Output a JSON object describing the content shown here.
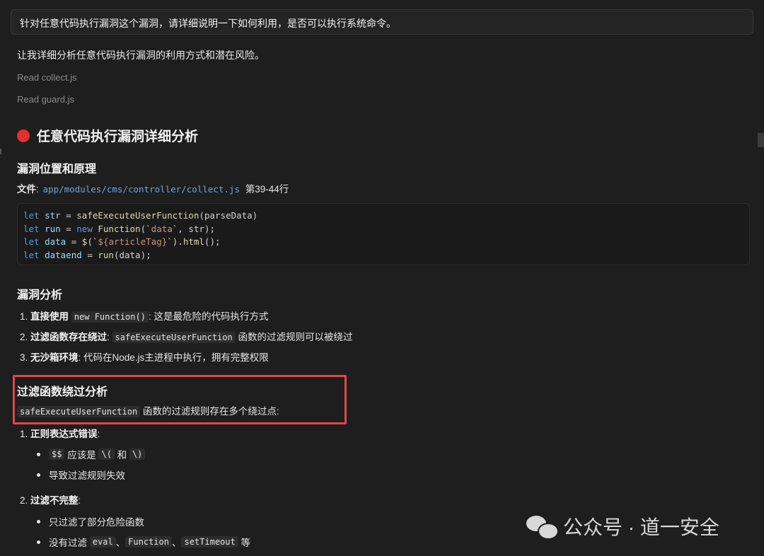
{
  "prompt": "针对任意代码执行漏洞这个漏洞，请详细说明一下如何利用，是否可以执行系统命令。",
  "intro": "让我详细分析任意代码执行漏洞的利用方式和潜在风险。",
  "reads": [
    {
      "label": "Read",
      "file": "collect.js"
    },
    {
      "label": "Read",
      "file": "guard.js"
    }
  ],
  "main_heading": "任意代码执行漏洞详细分析",
  "section1": {
    "heading": "漏洞位置和原理",
    "file_label": "文件",
    "file_path": "app/modules/cms/controller/collect.js",
    "lines": "第39-44行"
  },
  "code": [
    {
      "kw": "let",
      "name": "str",
      "rest": " = ",
      "fn": "safeExecuteUserFunction",
      "args": "(parseData)"
    },
    {
      "kw": "let",
      "name": "run",
      "rest": " = ",
      "kw2": "new",
      "fn": "Function",
      "args1": "(`",
      "strv": "data",
      "args2": "`, str);"
    },
    {
      "kw": "let",
      "name": "data",
      "rest": " = ",
      "fn": "$",
      "args1": "(`",
      "strv": "${articleTag}",
      "args2": "`).",
      "fn2": "html",
      "args3": "();"
    },
    {
      "kw": "let",
      "name": "dataend",
      "rest": " = ",
      "fn": "run",
      "args": "(data);"
    }
  ],
  "section2": {
    "heading": "漏洞分析",
    "items": [
      {
        "num": "1.",
        "bold": "直接使用",
        "code": "new Function()",
        "text": ": 这是最危险的代码执行方式"
      },
      {
        "num": "2.",
        "bold": "过滤函数存在绕过",
        "sep": ": ",
        "code": "safeExecuteUserFunction",
        "text": " 函数的过滤规则可以被绕过"
      },
      {
        "num": "3.",
        "bold": "无沙箱环境",
        "text": ": 代码在Node.js主进程中执行，拥有完整权限"
      }
    ]
  },
  "section3": {
    "heading": "过滤函数绕过分析",
    "code": "safeExecuteUserFunction",
    "text": " 函数的过滤规则存在多个绕过点:"
  },
  "regex_item": {
    "num": "1.",
    "bold": "正则表达式错误",
    "sep": ":",
    "bullets": [
      {
        "code1": "$$",
        "t1": " 应该是 ",
        "code2": "\\(",
        "t2": " 和 ",
        "code3": "\\)"
      },
      {
        "text": "导致过滤规则失效"
      }
    ]
  },
  "incomplete_item": {
    "num": "2.",
    "bold": "过滤不完整",
    "sep": ":",
    "bullets": [
      {
        "text": "只过滤了部分危险函数"
      },
      {
        "t1": "没有过滤 ",
        "code1": "eval",
        "t2": "、",
        "code2": "Function",
        "t3": "、",
        "code3": "setTimeout",
        "t4": " 等"
      }
    ]
  },
  "watermark": "公众号 · 道一安全",
  "colors": {
    "accent_red": "#e0302f",
    "highlight_border": "#e0464a",
    "link": "#6ea6dc"
  }
}
